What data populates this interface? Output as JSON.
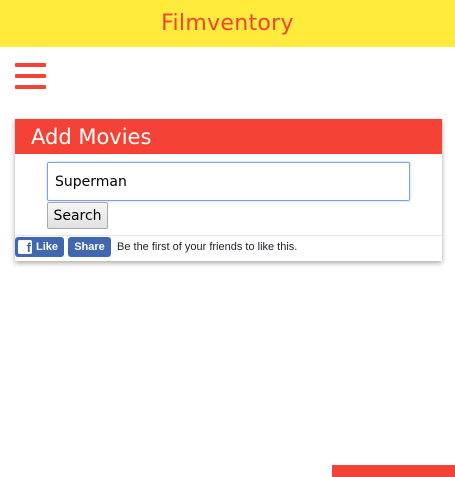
{
  "header": {
    "title": "Filmventory"
  },
  "menu": {
    "icon": "hamburger-menu-icon"
  },
  "add_movies": {
    "title": "Add Movies",
    "search_value": "Superman",
    "search_button_label": "Search"
  },
  "facebook": {
    "like_icon": "facebook-f-icon",
    "like_label": "Like",
    "share_label": "Share",
    "social_text": "Be the first of your friends to like this."
  },
  "colors": {
    "header_bg": "#ffeb3b",
    "accent": "#f44336",
    "facebook_blue": "#4267b2"
  }
}
